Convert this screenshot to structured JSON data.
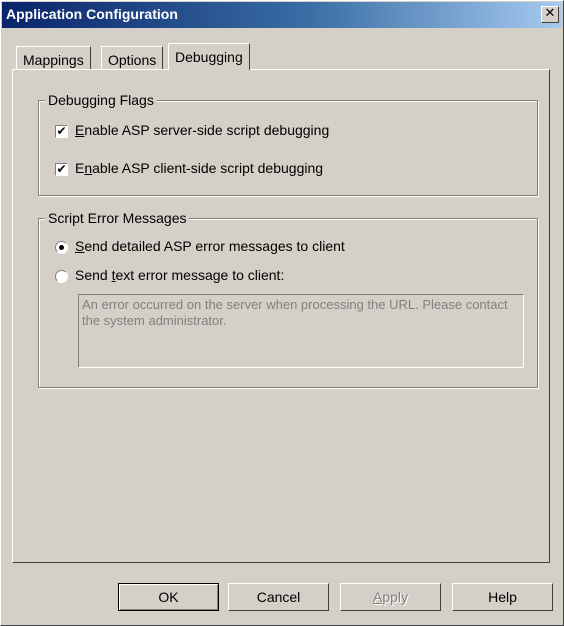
{
  "window": {
    "title": "Application Configuration",
    "close_label": "✕"
  },
  "tabs": [
    {
      "label": "Mappings",
      "active": false
    },
    {
      "label": "Options",
      "active": false
    },
    {
      "label": "Debugging",
      "active": true
    }
  ],
  "debugging_flags": {
    "legend": "Debugging Flags",
    "server": {
      "pre": "",
      "key": "E",
      "post": "nable ASP server-side script debugging",
      "checked": true
    },
    "client": {
      "pre": "E",
      "key": "n",
      "post": "able ASP client-side script debugging",
      "checked": true
    }
  },
  "script_errors": {
    "legend": "Script Error Messages",
    "detailed": {
      "pre": "",
      "key": "S",
      "post": "end detailed ASP error messages to client",
      "selected": true
    },
    "text": {
      "pre": "Send ",
      "key": "t",
      "post": "ext error message to client:",
      "selected": false
    },
    "message_text": "An error occurred on the server when processing the URL.  Please contact the system administrator."
  },
  "buttons": {
    "ok": "OK",
    "cancel": "Cancel",
    "apply_key": "A",
    "apply_rest": "pply",
    "help": "Help"
  },
  "glyphs": {
    "check": "✔"
  }
}
